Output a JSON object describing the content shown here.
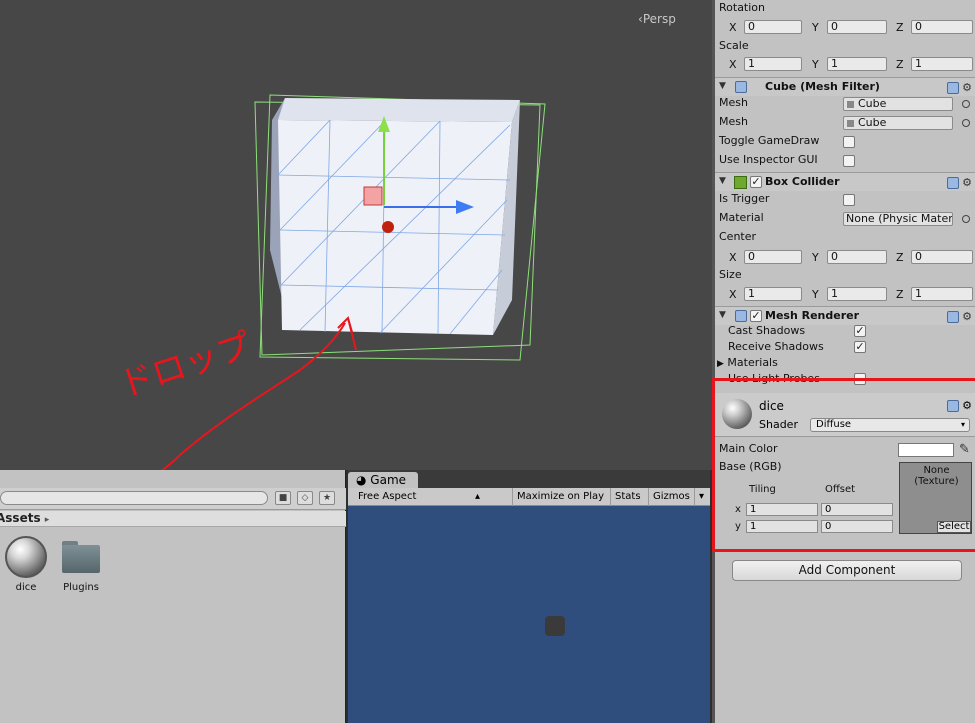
{
  "scene": {
    "persp_label": "Persp",
    "annotation": "ドロップ"
  },
  "project": {
    "breadcrumb": "Assets",
    "assets": [
      {
        "name": "dice",
        "icon": "material-sphere-icon"
      },
      {
        "name": "Plugins",
        "icon": "folder-icon"
      }
    ]
  },
  "game": {
    "tab_label": "Game",
    "aspect": "Free Aspect",
    "maximize": "Maximize on Play",
    "stats": "Stats",
    "gizmos": "Gizmos"
  },
  "inspector": {
    "rotation_label": "Rotation",
    "rotation": {
      "x": "0",
      "y": "0",
      "z": "0"
    },
    "scale_label": "Scale",
    "scale": {
      "x": "1",
      "y": "1",
      "z": "1"
    },
    "axis_x": "X",
    "axis_y": "Y",
    "axis_z": "Z",
    "mesh_filter": {
      "title": "Cube (Mesh Filter)",
      "mesh_label": "Mesh",
      "mesh_value": "Cube",
      "mesh2_label": "Mesh",
      "mesh2_value": "Cube",
      "toggle_label": "Toggle GameDraw",
      "use_inspector_label": "Use Inspector GUI"
    },
    "box_collider": {
      "title": "Box Collider",
      "is_trigger_label": "Is Trigger",
      "material_label": "Material",
      "material_value": "None (Physic Mater",
      "center_label": "Center",
      "center": {
        "x": "0",
        "y": "0",
        "z": "0"
      },
      "size_label": "Size",
      "size": {
        "x": "1",
        "y": "1",
        "z": "1"
      }
    },
    "mesh_renderer": {
      "title": "Mesh Renderer",
      "cast_shadows_label": "Cast Shadows",
      "receive_shadows_label": "Receive Shadows",
      "materials_label": "Materials",
      "light_probes_label": "Use Light Probes"
    },
    "material": {
      "name": "dice",
      "shader_label": "Shader",
      "shader_value": "Diffuse",
      "main_color_label": "Main Color",
      "base_label": "Base (RGB)",
      "tiling_label": "Tiling",
      "offset_label": "Offset",
      "x_label": "x",
      "y_label": "y",
      "tiling": {
        "x": "1",
        "y": "1"
      },
      "offset": {
        "x": "0",
        "y": "0"
      },
      "texture_none": "None",
      "texture_type": "(Texture)",
      "select_label": "Select"
    },
    "add_component": "Add Component"
  },
  "colors": {
    "highlight_box": "#e8161c",
    "annotation_red": "#e8161c",
    "scene_bg": "#474747",
    "game_bg": "#2f4d7d"
  }
}
